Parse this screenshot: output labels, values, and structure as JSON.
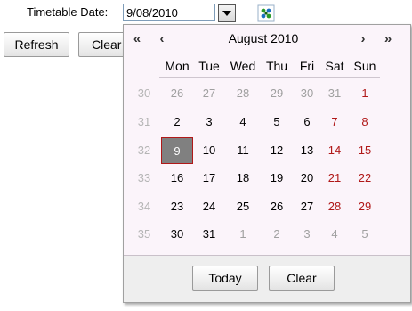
{
  "form": {
    "label": "Timetable Date:",
    "date_value": "9/08/2010",
    "refresh_label": "Refresh",
    "clear_label": "Clear"
  },
  "calendar": {
    "title": "August 2010",
    "nav": {
      "prev_year": "«",
      "prev_month": "‹",
      "next_month": "›",
      "next_year": "»"
    },
    "day_names": [
      "Mon",
      "Tue",
      "Wed",
      "Thu",
      "Fri",
      "Sat",
      "Sun"
    ],
    "selected_day": "9",
    "weeks": [
      {
        "week": "30",
        "days": [
          {
            "d": "26",
            "other": true
          },
          {
            "d": "27",
            "other": true
          },
          {
            "d": "28",
            "other": true
          },
          {
            "d": "29",
            "other": true
          },
          {
            "d": "30",
            "other": true
          },
          {
            "d": "31",
            "other": true
          },
          {
            "d": "1",
            "weekend": true
          }
        ]
      },
      {
        "week": "31",
        "days": [
          {
            "d": "2"
          },
          {
            "d": "3"
          },
          {
            "d": "4"
          },
          {
            "d": "5"
          },
          {
            "d": "6"
          },
          {
            "d": "7",
            "weekend": true
          },
          {
            "d": "8",
            "weekend": true
          }
        ]
      },
      {
        "week": "32",
        "days": [
          {
            "d": "9",
            "selected": true
          },
          {
            "d": "10"
          },
          {
            "d": "11"
          },
          {
            "d": "12"
          },
          {
            "d": "13"
          },
          {
            "d": "14",
            "weekend": true
          },
          {
            "d": "15",
            "weekend": true
          }
        ]
      },
      {
        "week": "33",
        "days": [
          {
            "d": "16"
          },
          {
            "d": "17"
          },
          {
            "d": "18"
          },
          {
            "d": "19"
          },
          {
            "d": "20"
          },
          {
            "d": "21",
            "weekend": true
          },
          {
            "d": "22",
            "weekend": true
          }
        ]
      },
      {
        "week": "34",
        "days": [
          {
            "d": "23"
          },
          {
            "d": "24"
          },
          {
            "d": "25"
          },
          {
            "d": "26"
          },
          {
            "d": "27"
          },
          {
            "d": "28",
            "weekend": true
          },
          {
            "d": "29",
            "weekend": true
          }
        ]
      },
      {
        "week": "35",
        "days": [
          {
            "d": "30"
          },
          {
            "d": "31"
          },
          {
            "d": "1",
            "other": true
          },
          {
            "d": "2",
            "other": true
          },
          {
            "d": "3",
            "other": true
          },
          {
            "d": "4",
            "other": true
          },
          {
            "d": "5",
            "other": true
          }
        ]
      }
    ],
    "today_label": "Today",
    "clear_label": "Clear"
  },
  "icons": {
    "calendar_picker": "calendar-picker-icon",
    "dropdown": "chevron-down-icon"
  },
  "colors": {
    "popup_bg": "#fbf4fa",
    "weekend": "#b01818",
    "other_month": "#a0a0a0",
    "selected_bg": "#808080"
  }
}
